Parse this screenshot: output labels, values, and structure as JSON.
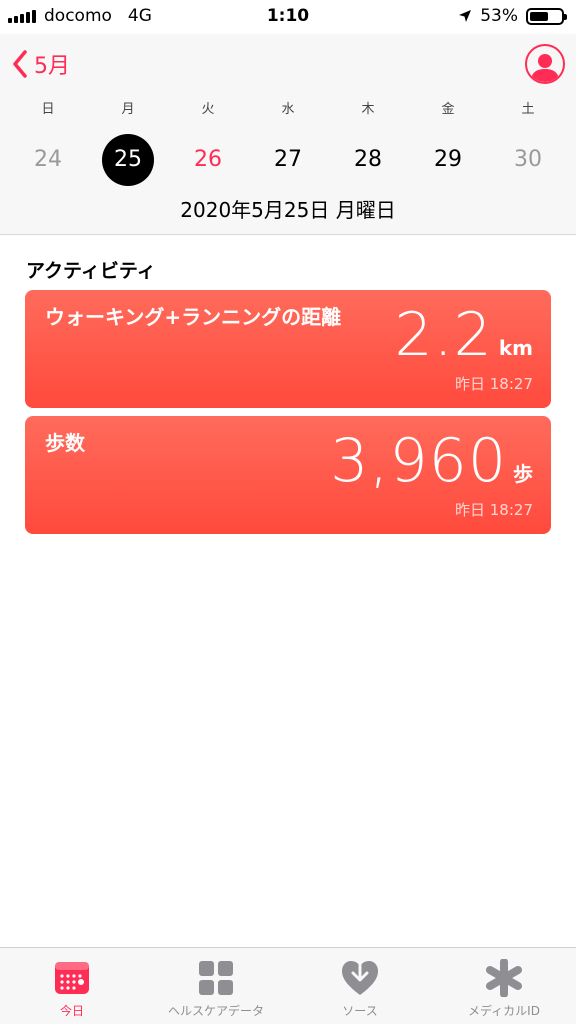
{
  "status": {
    "carrier": "docomo",
    "network": "4G",
    "time": "1:10",
    "battery": "53%"
  },
  "header": {
    "back_label": "5月",
    "profile_icon": "person-icon"
  },
  "week": {
    "days": [
      "日",
      "月",
      "火",
      "水",
      "木",
      "金",
      "土"
    ],
    "dates": [
      "24",
      "25",
      "26",
      "27",
      "28",
      "29",
      "30"
    ],
    "selected_index": 1,
    "full_date": "2020年5月25日 月曜日"
  },
  "activity": {
    "title": "アクティビティ",
    "cards": [
      {
        "label": "ウォーキング+ランニングの距離",
        "value": "2.2",
        "unit": "km",
        "time": "昨日 18:27"
      },
      {
        "label": "歩数",
        "value": "3,960",
        "unit": "歩",
        "time": "昨日 18:27"
      }
    ]
  },
  "tabs": [
    {
      "label": "今日",
      "icon": "calendar-icon",
      "active": true
    },
    {
      "label": "ヘルスケアデータ",
      "icon": "grid-icon",
      "active": false
    },
    {
      "label": "ソース",
      "icon": "heart-download-icon",
      "active": false
    },
    {
      "label": "メディカルID",
      "icon": "asterisk-icon",
      "active": false
    }
  ],
  "colors": {
    "accent": "#ff2d55",
    "card": "#ff5a4a"
  }
}
